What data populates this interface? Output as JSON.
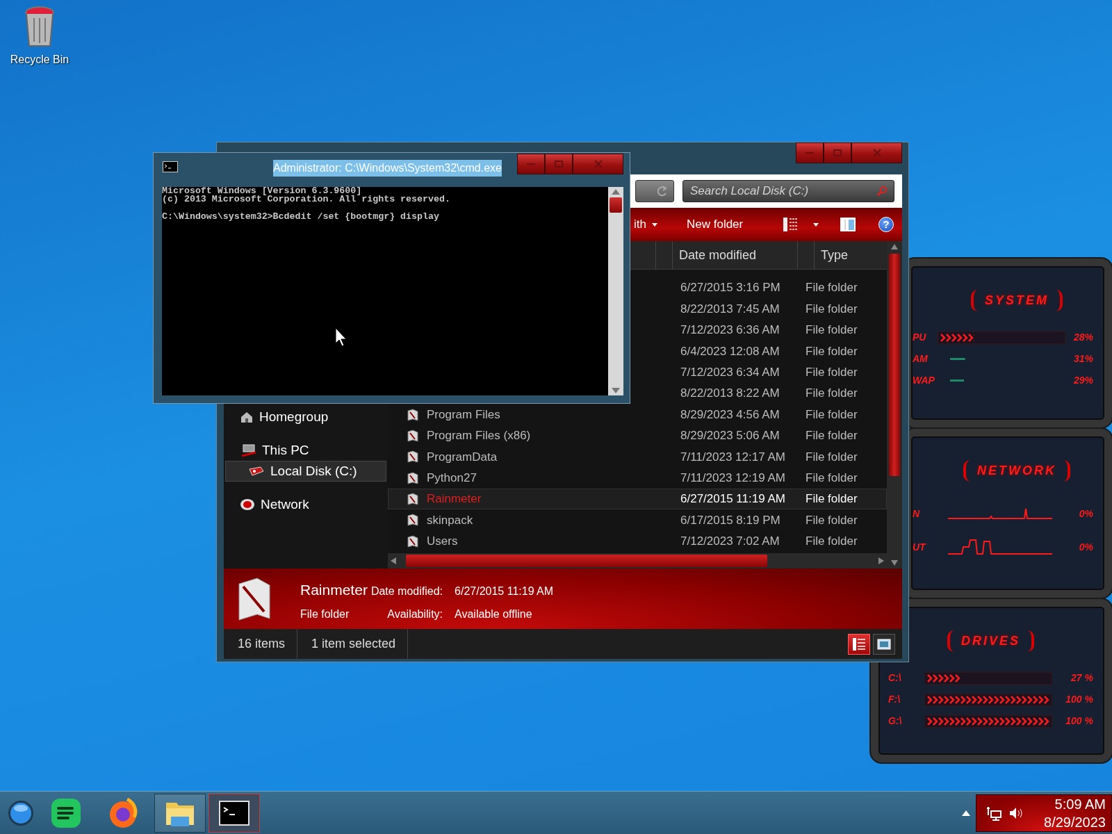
{
  "desktop": {
    "icons": [
      {
        "label": "Recycle Bin",
        "kind": "recycle"
      }
    ]
  },
  "explorer": {
    "search": {
      "placeholder": "Search Local Disk (C:)"
    },
    "toolbar": [
      {
        "kind": "menu",
        "label": "ith"
      },
      {
        "kind": "button",
        "label": "New folder"
      },
      {
        "kind": "view"
      },
      {
        "kind": "pane"
      },
      {
        "kind": "help",
        "label": "?"
      }
    ],
    "columns": [
      "Date modified",
      "Type"
    ],
    "nav": [
      {
        "label": "Homegroup",
        "kind": "homegroup",
        "selected": false
      },
      {
        "label": "This PC",
        "kind": "pc",
        "selected": false,
        "children": [
          {
            "label": "Local Disk (C:)",
            "kind": "disk",
            "selected": true
          }
        ]
      },
      {
        "label": "Network",
        "kind": "network",
        "selected": false
      }
    ],
    "rows": [
      {
        "date": "6/27/2015 3:16 PM",
        "type": "File folder",
        "selected": false
      },
      {
        "date": "8/22/2013 7:45 AM",
        "type": "File folder",
        "selected": false
      },
      {
        "date": "7/12/2023 6:36 AM",
        "type": "File folder",
        "selected": false
      },
      {
        "date": "6/4/2023 12:08 AM",
        "type": "File folder",
        "selected": false
      },
      {
        "date": "7/12/2023 6:34 AM",
        "type": "File folder",
        "selected": false
      },
      {
        "date": "8/22/2013 8:22 AM",
        "type": "File folder",
        "selected": false
      },
      {
        "name": "Program Files",
        "date": "8/29/2023 4:56 AM",
        "type": "File folder",
        "selected": false
      },
      {
        "name": "Program Files (x86)",
        "date": "8/29/2023 5:06 AM",
        "type": "File folder",
        "selected": false
      },
      {
        "name": "ProgramData",
        "date": "7/11/2023 12:17 AM",
        "type": "File folder",
        "selected": false
      },
      {
        "name": "Python27",
        "date": "7/11/2023 12:19 AM",
        "type": "File folder",
        "selected": false
      },
      {
        "name": "Rainmeter",
        "date": "6/27/2015 11:19 AM",
        "type": "File folder",
        "selected": true
      },
      {
        "name": "skinpack",
        "date": "6/17/2015 8:19 PM",
        "type": "File folder",
        "selected": false
      },
      {
        "name": "Users",
        "date": "7/12/2023 7:02 AM",
        "type": "File folder",
        "selected": false
      }
    ],
    "details": {
      "name": "Rainmeter",
      "type": "File folder",
      "fields": [
        {
          "label": "Date modified:",
          "value": "6/27/2015 11:19 AM"
        },
        {
          "label": "Availability:",
          "value": "Available offline"
        }
      ]
    },
    "status_bar": [
      "16 items",
      "1 item selected"
    ],
    "views": [
      {
        "kind": "details",
        "selected": true
      },
      {
        "kind": "preview",
        "selected": false
      }
    ]
  },
  "cmd": {
    "title": "Administrator: C:\\Windows\\System32\\cmd.exe",
    "title_highlighted": true,
    "blocks": [
      [
        "Microsoft Windows [Version 6.3.9600]",
        "(c) 2013 Microsoft Corporation. All rights reserved."
      ],
      [
        "C:\\Windows\\system32>Bcdedit /set {bootmgr} display"
      ]
    ]
  },
  "rainmeter": {
    "panels": [
      {
        "title": "SYSTEM",
        "rows": [
          {
            "kind": "chevrons",
            "label": "PU",
            "level": 0.28,
            "value": "28%"
          },
          {
            "kind": "line",
            "label": "AM",
            "level": 0.31,
            "value": "31%"
          },
          {
            "kind": "line",
            "label": "WAP",
            "level": 0.29,
            "value": "29%"
          }
        ]
      },
      {
        "title": "NETWORK",
        "rows": [
          {
            "kind": "graph",
            "label": "N",
            "value": "0%"
          },
          {
            "kind": "graph",
            "label": "UT",
            "value": "0%"
          }
        ]
      },
      {
        "title": "DRIVES",
        "rows": [
          {
            "kind": "chevrons",
            "label": "C:\\",
            "level": 0.27,
            "value": "27 %"
          },
          {
            "kind": "chevrons",
            "label": "F:\\",
            "level": 1,
            "value": "100 %"
          },
          {
            "kind": "chevrons",
            "label": "G:\\",
            "level": 1,
            "value": "100 %"
          }
        ]
      }
    ]
  },
  "taskbar": {
    "apps": [
      {
        "kind": "orb",
        "running": false,
        "active": false
      },
      {
        "kind": "notes",
        "running": false,
        "active": false
      },
      {
        "kind": "firefox",
        "running": false,
        "active": false
      },
      {
        "kind": "explorer",
        "running": true,
        "active": false
      },
      {
        "kind": "cmd",
        "running": true,
        "active": true
      }
    ],
    "clock": {
      "time": "5:09 AM",
      "date": "8/29/2023"
    }
  }
}
